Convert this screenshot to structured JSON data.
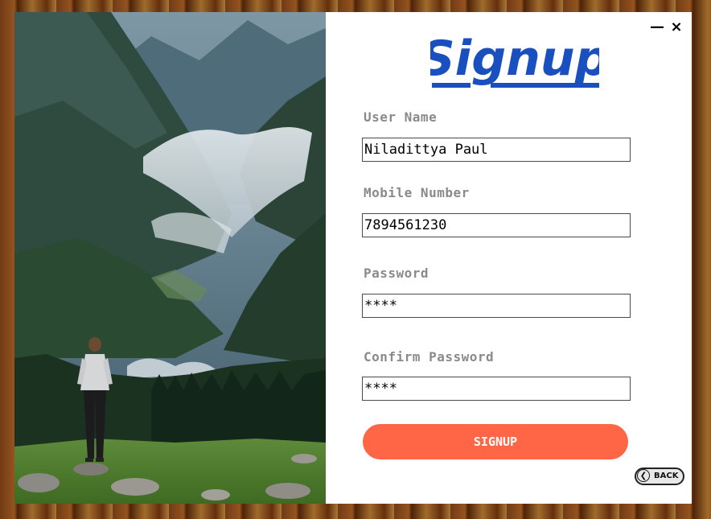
{
  "header": {
    "logo_text": "Signup",
    "minimize_label": "—",
    "close_label": "×"
  },
  "form": {
    "username": {
      "label": "User Name",
      "value": "Niladittya Paul"
    },
    "mobile": {
      "label": "Mobile Number",
      "value": "7894561230"
    },
    "password": {
      "label": "Password",
      "value": "****"
    },
    "confirm_password": {
      "label": "Confirm Password",
      "value": "****"
    }
  },
  "actions": {
    "signup_label": "SIGNUP",
    "back_label": "BACK",
    "back_icon": "chevron-left-icon"
  },
  "colors": {
    "logo_blue": "#1a4fc0",
    "button_orange": "#ff6645",
    "label_gray": "#8a8a8a"
  }
}
